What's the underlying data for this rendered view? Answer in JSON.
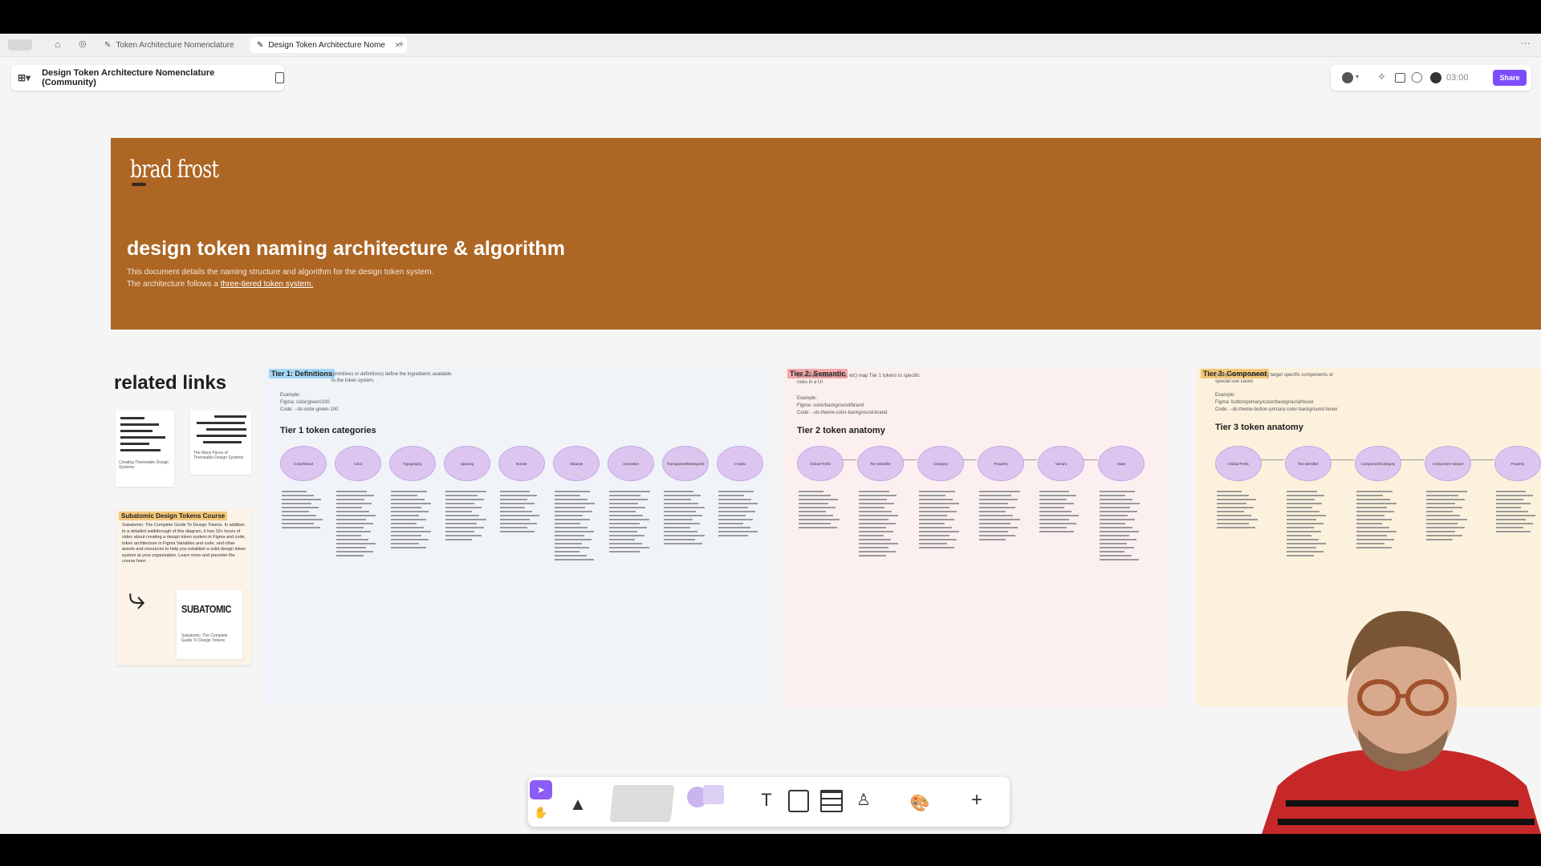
{
  "tabs": [
    {
      "label": "Token Architecture Nomenclature",
      "icon": "pen-icon"
    },
    {
      "label": "Design Token Architecture Nome",
      "icon": "pen-icon"
    }
  ],
  "filebar": {
    "title": "Design Token Architecture Nomenclature (Community)"
  },
  "rightbar": {
    "timer": "03:00",
    "share_label": "Share"
  },
  "banner": {
    "logo": "brad frost",
    "heading": "design token naming architecture & algorithm",
    "description": "This document details the naming structure and algorithm for the design token system. The architecture follows a",
    "link_text": "three-tiered token system."
  },
  "related": {
    "heading": "related links",
    "thumb1_caption": "Creating Themeable Design Systems",
    "thumb2_caption": "The Many Faces of Themeable Design Systems",
    "course_tag": "Subatomic Design Tokens Course",
    "course_text": "Subatomic: The Complete Guide To Design Tokens. In addition to a detailed walkthrough of this diagram, it has 10+ hours of video about creating a design token system in Figma and code, token architecture in Figma Variables and code, and other assets and resources to help you establish a solid design token system at your organization. Learn more and preorder the course here:",
    "course_logo": "SUBATOMIC",
    "course_caption": "Subatomic: The Complete Guide To Design Tokens"
  },
  "tier1": {
    "tag": "Tier 1: Definitions",
    "intro": "(primitives or definitions) define the ingredients available to the token system.",
    "example_label": "Example:",
    "example_figma": "Figma: color/green/100",
    "example_code": "Code: --ds-color-green-100",
    "section_title": "Tier 1 token categories",
    "categories": [
      "Color/Brand",
      "Color",
      "Typography",
      "Spacing",
      "Border",
      "Shadow",
      "Animation",
      "Transparent/Breakpoint",
      "z-index"
    ]
  },
  "tier2": {
    "tag": "Tier 2: Semantic",
    "intro": "(semantic, alias, theme, etc) map Tier 1 tokens to specific roles in a UI",
    "example_label": "Example:",
    "example_figma": "Figma: color/background/brand",
    "example_code": "Code: --ds-theme-color-background-brand",
    "section_title": "Tier 2 token anatomy",
    "parts": [
      "Global Prefix",
      "Tier Identifier",
      "Category",
      "Property",
      "Variant",
      "State"
    ]
  },
  "tier3": {
    "tag": "Tier 3: Component",
    "intro": "(component or overrides) target specific components or special use cases",
    "example_label": "Example:",
    "example_figma": "Figma: button/primary/color/background/hover",
    "example_code": "Code: --ds-theme-button-primary-color-background-hover",
    "section_title": "Tier 3 token anatomy",
    "parts": [
      "Global Prefix",
      "Tier Identifier",
      "Component/Category",
      "Component Variant",
      "Property"
    ]
  },
  "colors": {
    "banner": "#ad6624",
    "tier1_tag": "#a6d8f5",
    "tier2_tag": "#f4a7a7",
    "tier3_tag": "#f3c77a",
    "accent": "#7c4dff",
    "circle": "#dcc6ef"
  }
}
